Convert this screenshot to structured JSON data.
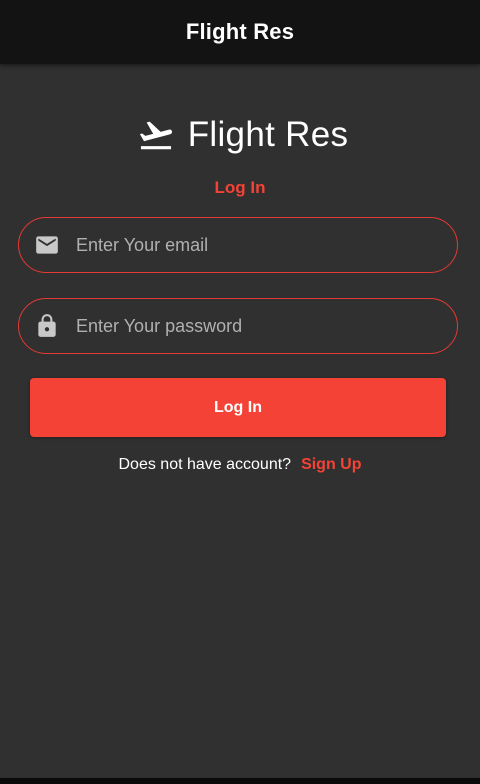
{
  "appbar": {
    "title": "Flight Res"
  },
  "brand": {
    "name": "Flight Res",
    "icon": "flight-takeoff-icon"
  },
  "form": {
    "mode_label": "Log In",
    "email": {
      "placeholder": "Enter Your email",
      "value": "",
      "icon": "mail-icon"
    },
    "password": {
      "placeholder": "Enter Your password",
      "value": "",
      "icon": "lock-icon"
    },
    "submit_label": "Log In"
  },
  "signup": {
    "prompt": "Does not have account?",
    "link_label": "Sign Up"
  },
  "colors": {
    "accent": "#f44336",
    "background": "#303030",
    "appbar": "#131313",
    "text": "#ffffff"
  }
}
